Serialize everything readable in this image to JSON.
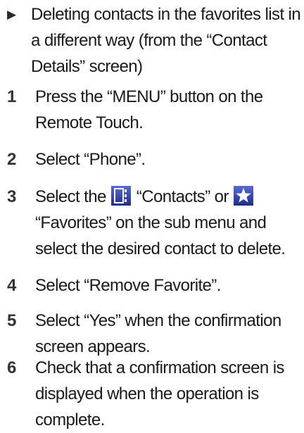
{
  "section": {
    "heading": "Deleting contacts in the favorites list in a different way (from the “Contact Details” screen)"
  },
  "steps": [
    {
      "number": "1",
      "text": "Press the “MENU” button on the Remote Touch."
    },
    {
      "number": "2",
      "text": "Select “Phone”."
    },
    {
      "number": "3",
      "text_before": "Select the",
      "icon1": "contacts-book-icon",
      "text_middle": "“Contacts” or",
      "icon2": "favorites-star-icon",
      "text_after": "“Favorites” on the sub menu and select the desired contact to delete."
    },
    {
      "number": "4",
      "text": "Select “Remove Favorite”."
    },
    {
      "number": "5",
      "text": "Select “Yes” when the confirmation screen appears."
    },
    {
      "number": "6",
      "text": "Check that a confirmation screen is displayed when the operation is complete."
    }
  ],
  "colors": {
    "icon_gradient_top": "#5a6ad0",
    "icon_gradient_bottom": "#1e2c8a",
    "icon_star": "#ffffff"
  }
}
